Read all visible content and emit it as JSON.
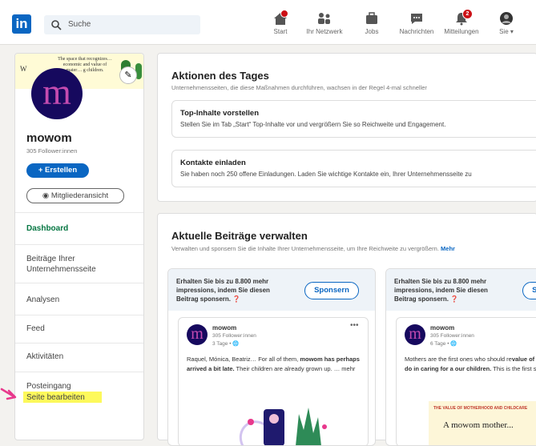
{
  "topbar": {
    "logo": "in",
    "search_placeholder": "Suche",
    "nav": [
      {
        "label": "Start",
        "icon": "house-icon",
        "badge": ""
      },
      {
        "label": "Ihr Netzwerk",
        "icon": "network-icon",
        "badge": ""
      },
      {
        "label": "Jobs",
        "icon": "briefcase-icon",
        "badge": ""
      },
      {
        "label": "Nachrichten",
        "icon": "chat-icon",
        "badge": ""
      },
      {
        "label": "Mitteilungen",
        "icon": "bell-icon",
        "badge": "2"
      },
      {
        "label": "Sie ▾",
        "icon": "avatar-icon",
        "badge": ""
      }
    ]
  },
  "sidebar": {
    "banner_text": "The space that recognizes… economic and value of mater… g children.",
    "banner_initial": "W",
    "avatar_letter": "m",
    "company_name": "mowom",
    "followers": "305 Follower:innen",
    "create_button": "+ Erstellen",
    "member_view_button": "Mitgliederansicht",
    "menu": [
      {
        "label": "Dashboard",
        "active": true
      },
      {
        "label": "Beiträge Ihrer Unternehmensseite",
        "active": false
      },
      {
        "label": "Analysen",
        "active": false
      },
      {
        "label": "Feed",
        "active": false
      },
      {
        "label": "Aktivitäten",
        "active": false
      },
      {
        "label": "Posteingang",
        "active": false
      },
      {
        "label": "Seite bearbeiten",
        "active": false,
        "highlighted": true
      }
    ]
  },
  "actions_card": {
    "title": "Aktionen des Tages",
    "subtitle": "Unternehmensseiten, die diese Maßnahmen durchführen, wachsen in der Regel 4-mal schneller",
    "items": [
      {
        "title": "Top-Inhalte vorstellen",
        "text": "Stellen Sie im Tab „Start“ Top-Inhalte vor und vergrößern Sie so Reichweite und Engagement."
      },
      {
        "title": "Kontakte einladen",
        "text": "Sie haben noch 250 offene Einladungen. Laden Sie wichtige Kontakte ein, Ihrer Unternehmensseite zu"
      }
    ]
  },
  "posts_card": {
    "title": "Aktuelle Beiträge verwalten",
    "subtitle": "Verwalten und sponsern Sie die Inhalte Ihrer Unternehmensseite, um Ihre Reichweite zu vergrößern.",
    "more_link": "Mehr",
    "posts": [
      {
        "promo": "Erhalten Sie bis zu 8.800 mehr impressions, indem Sie diesen Beitrag sponsern.",
        "sponsor_button": "Sponsern",
        "author": "mowom",
        "followers": "305 Follower:innen",
        "date": "3 Tage • 🌐",
        "text_pre": "Raquel, Mónica, Beatriz… For all of them, ",
        "text_bold": "mowom has perhaps arrived a bit late.",
        "text_post": " Their children are already grown up. … mehr"
      },
      {
        "promo": "Erhalten Sie bis zu 8.800 mehr impressions, indem Sie diesen Beitrag sponsern.",
        "sponsor_button": "Sponsern",
        "author": "mowom",
        "followers": "305 Follower:innen",
        "date": "6 Tage • 🌐",
        "text_pre": "Mothers are the first ones who should re",
        "text_bold": "value of the work we do in caring for a our children.",
        "text_post": " This is the first step. … mehr",
        "image_caption_small": "THE VALUE OF MOTHERHOOD AND CHILDCARE",
        "image_caption": "A mowom mother..."
      }
    ]
  },
  "colors": {
    "brand": "#0a66c2",
    "accent_green": "#057642",
    "highlight": "#fdf95b",
    "arrow": "#e8388c",
    "avatar_bg": "#16095e",
    "avatar_letter": "#c44bb0"
  }
}
